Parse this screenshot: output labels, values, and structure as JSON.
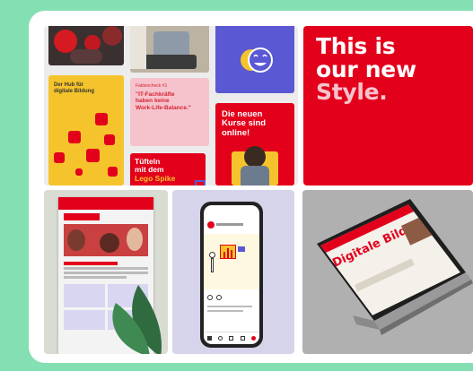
{
  "colors": {
    "background": "#84e0b3",
    "brand_red": "#e3001b",
    "brand_yellow": "#f5c42c",
    "brand_pink": "#f6c3cd",
    "brand_purple": "#5b58d3"
  },
  "collage": {
    "hub": {
      "text": "Der Hub für\ndigitale Bildung"
    },
    "quote": {
      "heading": "Faktencheck #1",
      "body": "\"IT-Fachkräfte\nhaben keine\nWork-Life-Balance.\""
    },
    "lego": {
      "line1": "Tüfteln",
      "line2": "mit dem",
      "line3": "Lego Spike"
    },
    "kurse": {
      "text": "Die neuen\nKurse sind\nonline!"
    },
    "emoji_icon": "smiling-face-icon"
  },
  "headline": {
    "line1": "This is",
    "line2": "our new",
    "line3": "Style."
  },
  "laptop": {
    "headline": "Digitale Bildung für alle."
  }
}
